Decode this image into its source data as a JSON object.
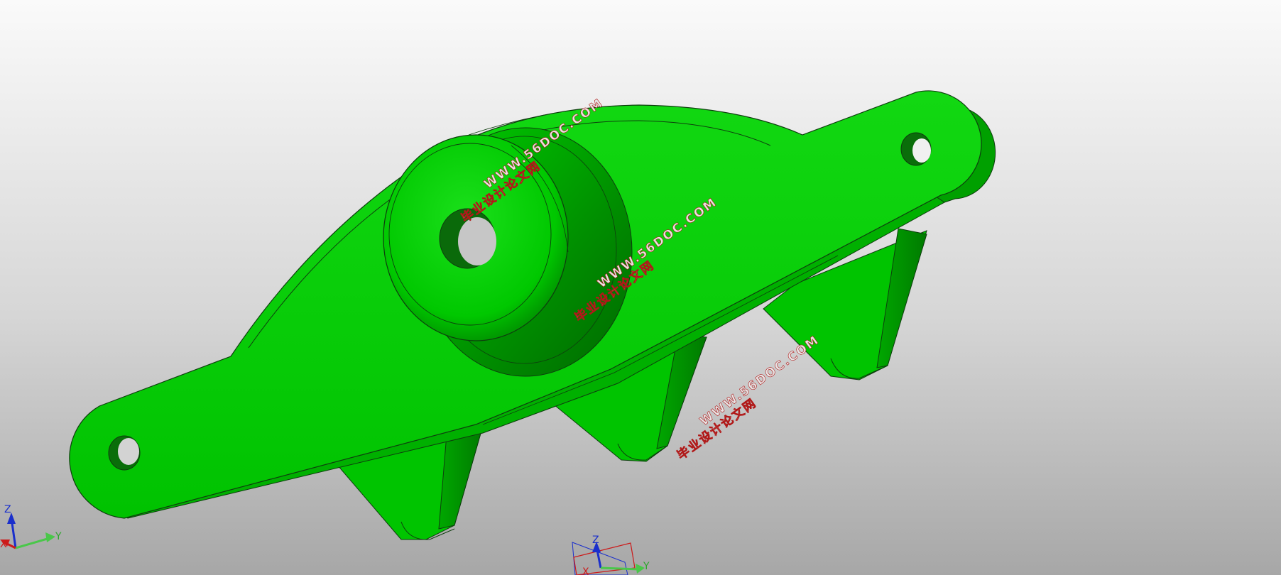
{
  "viewport": {
    "background_top": "#fafafa",
    "background_bottom": "#a7a7a7"
  },
  "model": {
    "color": "#00cc00",
    "dark_color": "#009500",
    "edge_color": "#0e3d0e"
  },
  "watermarks": [
    {
      "cn": "毕业设计论文网",
      "url": "WWW.56DOC.COM"
    },
    {
      "cn": "毕业设计论文网",
      "url": "WWW.56DOC.COM"
    },
    {
      "cn": "毕业设计论文网",
      "url": "WWW.56DOC.COM"
    }
  ],
  "triad_corner": {
    "z": "Z",
    "y": "Y",
    "x": "X"
  },
  "triad_center": {
    "z": "Z",
    "y": "Y",
    "x": "X"
  }
}
